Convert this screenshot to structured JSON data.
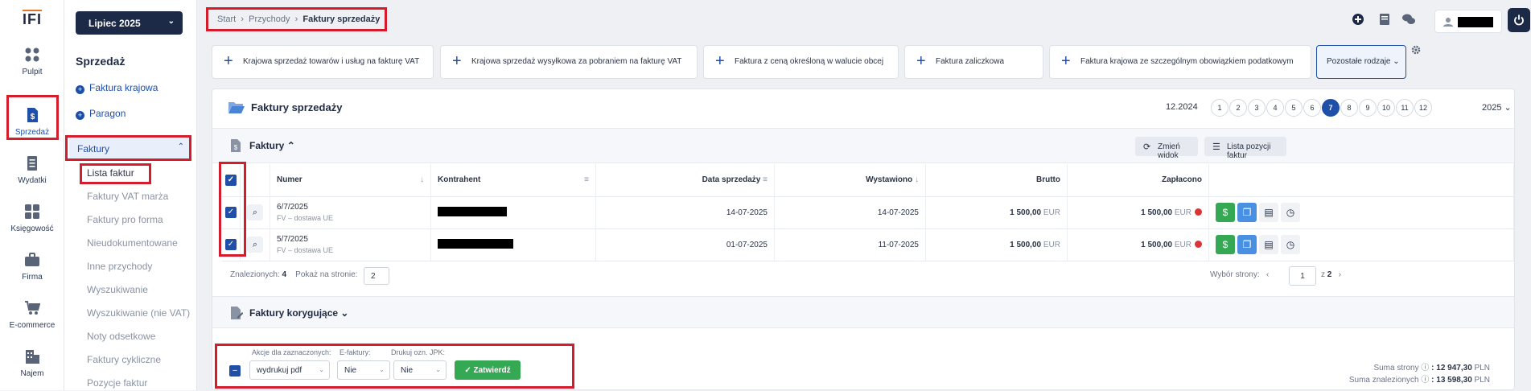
{
  "rail": {
    "logo": "IFI",
    "items": [
      {
        "label": "Pulpit",
        "icon": "grid-icon"
      },
      {
        "label": "Sprzedaż",
        "icon": "invoice-dollar-icon",
        "active": true
      },
      {
        "label": "Wydatki",
        "icon": "document-icon"
      },
      {
        "label": "Księgowość",
        "icon": "calculator-icon"
      },
      {
        "label": "Firma",
        "icon": "briefcase-icon"
      },
      {
        "label": "E-commerce",
        "icon": "cart-icon"
      },
      {
        "label": "Najem",
        "icon": "building-icon"
      }
    ]
  },
  "menu": {
    "month": "Lipiec 2025",
    "section": "Sprzedaż",
    "links": [
      "Faktura krajowa",
      "Paragon"
    ],
    "group": "Faktury",
    "items": [
      "Lista faktur",
      "Faktury VAT marża",
      "Faktury pro forma",
      "Nieudokumentowane",
      "Inne przychody",
      "Wyszukiwanie",
      "Wyszukiwanie (nie VAT)",
      "Noty odsetkowe",
      "Faktury cykliczne",
      "Pozycje faktur"
    ]
  },
  "breadcrumb": {
    "a": "Start",
    "b": "Przychody",
    "c": "Faktury sprzedaży"
  },
  "quick": [
    "Krajowa sprzedaż towarów i usług na fakturę VAT",
    "Krajowa sprzedaż wysyłkowa za pobraniem na fakturę VAT",
    "Faktura z ceną określoną w walucie obcej",
    "Faktura zaliczkowa",
    "Faktura krajowa ze szczególnym obowiązkiem podatkowym"
  ],
  "quick_other": "Pozostałe rodzaje",
  "panel": {
    "title": "Faktury sprzedaży",
    "period": "12.2024",
    "pages": [
      "1",
      "2",
      "3",
      "4",
      "5",
      "6",
      "7",
      "8",
      "9",
      "10",
      "11",
      "12"
    ],
    "active_page": "7",
    "year": "2025",
    "section": "Faktury",
    "btn_view": "Zmień widok",
    "btn_items": "Lista pozycji faktur",
    "columns": {
      "number": "Numer",
      "contractor": "Kontrahent",
      "sale_date": "Data sprzedaży",
      "issued": "Wystawiono",
      "gross": "Brutto",
      "paid": "Zapłacono"
    },
    "rows": [
      {
        "number": "6/7/2025",
        "type": "FV – dostawa UE",
        "sale_date": "14-07-2025",
        "issued": "14-07-2025",
        "gross": "1 500,00",
        "paid": "1 500,00",
        "currency": "EUR"
      },
      {
        "number": "5/7/2025",
        "type": "FV – dostawa UE",
        "sale_date": "01-07-2025",
        "issued": "11-07-2025",
        "gross": "1 500,00",
        "paid": "1 500,00",
        "currency": "EUR"
      }
    ],
    "found_label": "Znalezionych:",
    "found_count": "4",
    "per_page_label": "Pokaż na stronie:",
    "per_page": "2",
    "page_select_label": "Wybór strony:",
    "page_current": "1",
    "page_of": "z",
    "page_total": "2",
    "correction_section": "Faktury korygujące"
  },
  "bulk": {
    "actions_label": "Akcje dla zaznaczonych:",
    "actions_value": "wydrukuj pdf",
    "einv_label": "E-faktury:",
    "einv_value": "Nie",
    "jpk_label": "Drukuj ozn. JPK:",
    "jpk_value": "Nie",
    "confirm": "Zatwierdź",
    "sum_page_label": "Suma strony",
    "sum_page": ": 12 947,30",
    "sum_found_label": "Suma znalezionych",
    "sum_found": ": 13 598,30",
    "currency": "PLN"
  },
  "colors": {
    "accent": "#1f4fa8",
    "navy": "#1d2a47",
    "success": "#34a853",
    "highlight": "#d41c2c"
  }
}
